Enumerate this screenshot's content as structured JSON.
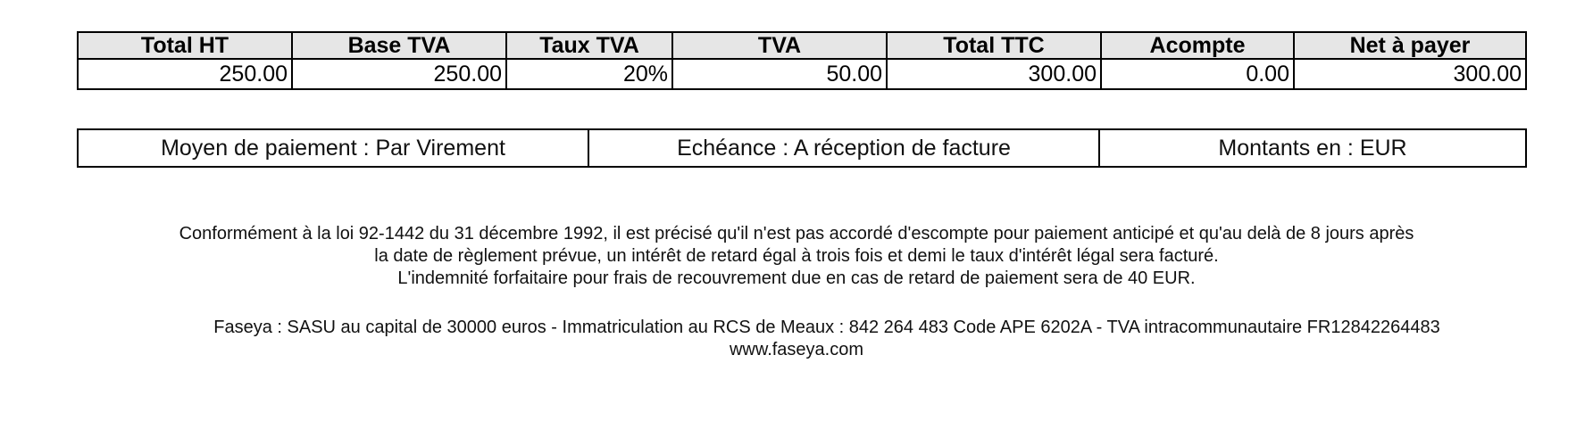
{
  "totals": {
    "headers": [
      "Total HT",
      "Base TVA",
      "Taux TVA",
      "TVA",
      "Total TTC",
      "Acompte",
      "Net à payer"
    ],
    "values": [
      "250.00",
      "250.00",
      "20%",
      "50.00",
      "300.00",
      "0.00",
      "300.00"
    ]
  },
  "terms": {
    "payment_method": "Moyen de paiement : Par Virement",
    "due_date": "Echéance : A réception de facture",
    "currency": "Montants en : EUR"
  },
  "legal": {
    "line1": "Conformément à la loi 92-1442 du 31 décembre 1992, il est précisé qu'il n'est pas accordé d'escompte pour paiement anticipé et qu'au delà de 8 jours après",
    "line2": "la date de règlement prévue, un intérêt de retard égal à trois fois et demi le taux d'intérêt légal sera facturé.",
    "line3": "L'indemnité forfaitaire pour frais de recouvrement due en cas de retard de paiement sera de 40 EUR."
  },
  "company": {
    "line1": "Faseya : SASU au capital de 30000 euros - Immatriculation au RCS de Meaux : 842 264 483 Code APE 6202A - TVA intracommunautaire FR12842264483",
    "website": "www.faseya.com"
  }
}
